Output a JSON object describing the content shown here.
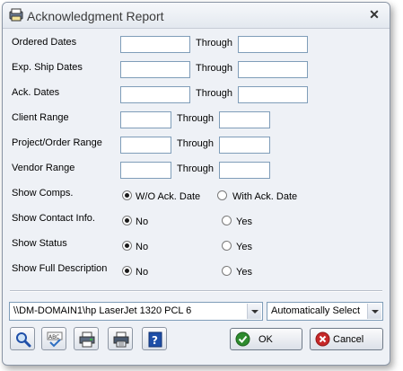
{
  "window": {
    "title": "Acknowledgment Report",
    "close_glyph": "✕"
  },
  "fields": {
    "ordered_dates": {
      "label": "Ordered Dates",
      "from": "",
      "through_label": "Through",
      "to": ""
    },
    "exp_ship_dates": {
      "label": "Exp. Ship Dates",
      "from": "",
      "through_label": "Through",
      "to": ""
    },
    "ack_dates": {
      "label": "Ack. Dates",
      "from": "",
      "through_label": "Through",
      "to": ""
    },
    "client_range": {
      "label": "Client Range",
      "from": "",
      "through_label": "Through",
      "to": ""
    },
    "project_order_range": {
      "label": "Project/Order Range",
      "from": "",
      "through_label": "Through",
      "to": ""
    },
    "vendor_range": {
      "label": "Vendor Range",
      "from": "",
      "through_label": "Through",
      "to": ""
    }
  },
  "options": {
    "show_comps": {
      "label": "Show Comps.",
      "choices": [
        "W/O Ack. Date",
        "With Ack. Date"
      ],
      "selected": "W/O Ack. Date"
    },
    "show_contact_info": {
      "label": "Show Contact Info.",
      "choices": [
        "No",
        "Yes"
      ],
      "selected": "No"
    },
    "show_status": {
      "label": "Show Status",
      "choices": [
        "No",
        "Yes"
      ],
      "selected": "No"
    },
    "show_full_description": {
      "label": "Show Full Description",
      "choices": [
        "No",
        "Yes"
      ],
      "selected": "No"
    }
  },
  "printer": {
    "value": "\\\\DM-DOMAIN1\\hp LaserJet 1320 PCL 6"
  },
  "tray": {
    "value": "Automatically Select"
  },
  "toolbar": {
    "icons": [
      "preview-icon",
      "spellcheck-icon",
      "print-setup-icon",
      "printer-icon",
      "help-icon"
    ],
    "ok_label": "OK",
    "cancel_label": "Cancel"
  },
  "colors": {
    "ok_check": "#2e8b2e",
    "cancel_x": "#c62828",
    "help_blue": "#1f4fa8"
  }
}
